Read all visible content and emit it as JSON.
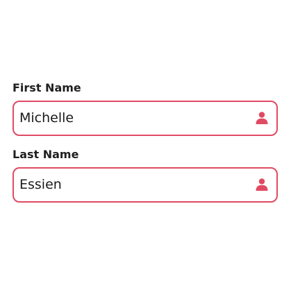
{
  "form": {
    "first_name": {
      "label": "First Name",
      "value": "Michelle",
      "icon": "user-icon"
    },
    "last_name": {
      "label": "Last Name",
      "value": "Essien",
      "icon": "user-icon"
    }
  },
  "colors": {
    "accent": "#e04a63",
    "label_text": "#1f1f1f",
    "input_text": "#1a1a1a",
    "background": "#ffffff"
  }
}
